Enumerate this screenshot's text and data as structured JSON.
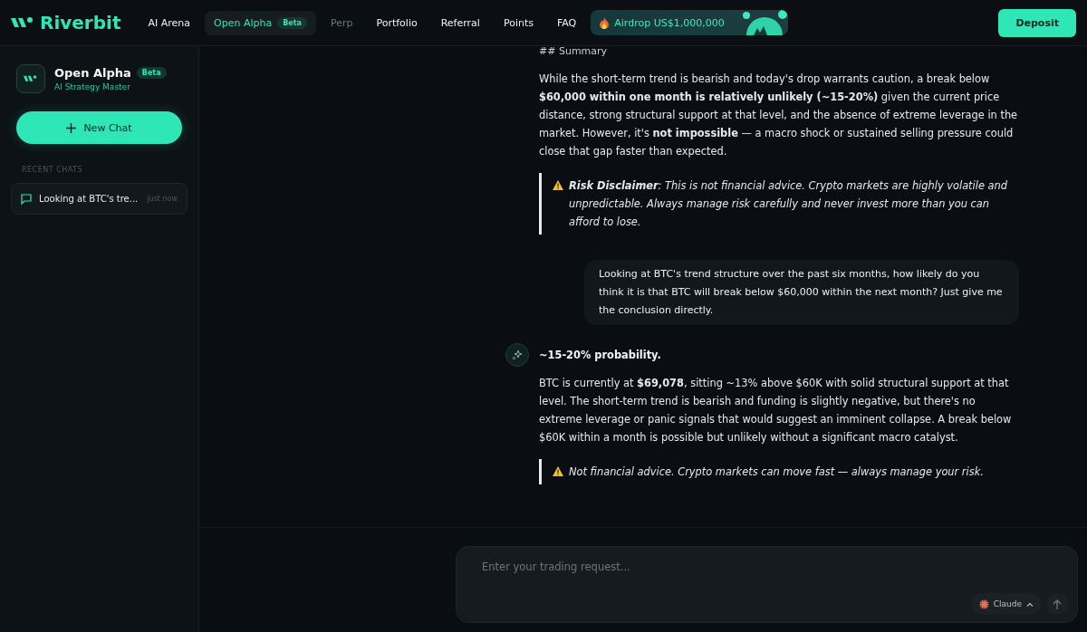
{
  "header": {
    "brand": "Riverbit",
    "nav": [
      {
        "label": "AI Arena",
        "selected": false,
        "disabled": false
      },
      {
        "label": "Open Alpha",
        "selected": true,
        "disabled": false,
        "badge": "Beta"
      },
      {
        "label": "Perp",
        "selected": false,
        "disabled": true
      },
      {
        "label": "Portfolio",
        "selected": false,
        "disabled": false
      },
      {
        "label": "Referral",
        "selected": false,
        "disabled": false
      },
      {
        "label": "Points",
        "selected": false,
        "disabled": false
      },
      {
        "label": "FAQ",
        "selected": false,
        "disabled": false
      }
    ],
    "airdrop": "Airdrop US$1,000,000",
    "deposit": "Deposit"
  },
  "sidebar": {
    "title": "Open Alpha",
    "badge": "Beta",
    "subtitle": "AI Strategy Master",
    "new_chat": "New Chat",
    "section": "RECENT CHATS",
    "chats": [
      {
        "title": "Looking at BTC's tre...",
        "time": "just now",
        "selected": false
      }
    ]
  },
  "messages": [
    {
      "kind": "heading",
      "text": "## Summary"
    },
    {
      "kind": "paragraph",
      "text": "While the short-term trend is bearish and today's drop warrants caution, a break below **$60,000 within one month is relatively unlikely (~15-20%)** given the current price distance, strong structural support at that level, and the absence of extreme leverage in the market. However, it's **not impossible** — a macro shock or sustained selling pressure could close that gap faster than expected."
    },
    {
      "kind": "quote",
      "text": "**Risk Disclaimer**: This is not financial advice. Crypto markets are highly volatile and unpredictable. Always manage risk carefully and never invest more than you can afford to lose."
    },
    {
      "kind": "user",
      "text": "Looking at BTC's trend structure over the past six months, how likely do you think it is that BTC will break below $60,000 within the next month? Just give me the conclusion directly."
    },
    {
      "kind": "answer_title",
      "text": "~15-20% probability."
    },
    {
      "kind": "paragraph",
      "text": "BTC is currently at **$69,078**, sitting ~13% above $60K with solid structural support at that level. The short-term trend is bearish and funding is slightly negative, but there's no extreme leverage or panic signals that would suggest an imminent collapse. A break below $60K within a month is possible but unlikely without a significant macro catalyst."
    },
    {
      "kind": "quote",
      "text": "Not financial advice. Crypto markets can move fast — always manage your risk."
    }
  ],
  "composer": {
    "placeholder": "Enter your trading request...",
    "model": "Claude"
  }
}
